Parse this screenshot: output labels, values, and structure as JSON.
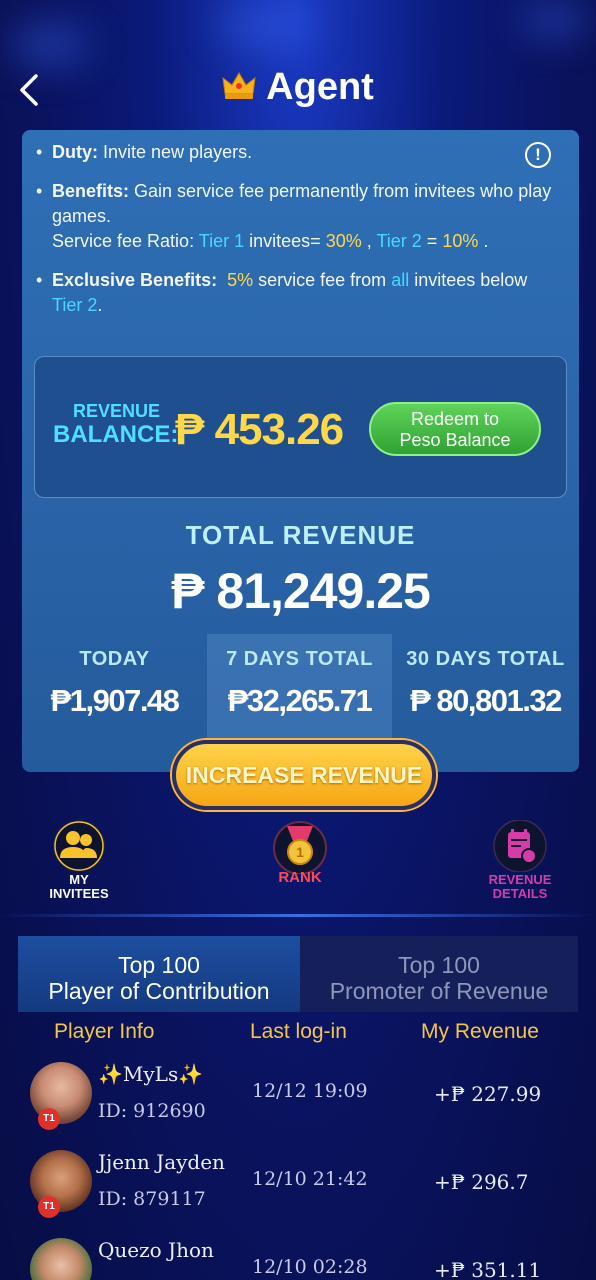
{
  "header": {
    "title": "Agent"
  },
  "info": {
    "duty_label": "Duty:",
    "duty_text": "Invite new players.",
    "benefits_label": "Benefits:",
    "benefits_text": "Gain service fee permanently from invitees who play games.",
    "ratio_prefix": "Service fee Ratio:",
    "tier1": "Tier 1",
    "invitees_eq": "invitees=",
    "tier1_pct": "30%",
    "comma": ",",
    "tier2": "Tier 2",
    "eq": "=",
    "tier2_pct": "10%",
    "period": ".",
    "excl_label": "Exclusive Benefits:",
    "excl_pct": "5%",
    "excl_mid": "service fee from",
    "all": "all",
    "excl_tail": "invitees below",
    "excl_tier": "Tier 2",
    "excl_end": "."
  },
  "balance": {
    "label_line1": "REVENUE",
    "label_line2": "BALANCE:",
    "value": "₱ 453.26",
    "redeem_line1": "Redeem to",
    "redeem_line2": "Peso Balance"
  },
  "total": {
    "label": "TOTAL  REVENUE",
    "value": "₱ 81,249.25"
  },
  "stats": [
    {
      "label": "TODAY",
      "value": "₱1,907.48"
    },
    {
      "label": "7 DAYS TOTAL",
      "value": "₱32,265.71"
    },
    {
      "label": "30 DAYS TOTAL",
      "value": "₱ 80,801.32"
    }
  ],
  "increase_button": "INCREASE REVENUE",
  "shortcuts": {
    "invitees_l1": "MY",
    "invitees_l2": "INVITEES",
    "rank": "RANK",
    "details_l1": "REVENUE",
    "details_l2": "DETAILS"
  },
  "tabs": {
    "active_l1": "Top 100",
    "active_l2": "Player of Contribution",
    "inactive_l1": "Top 100",
    "inactive_l2": "Promoter of Revenue"
  },
  "table": {
    "headers": [
      "Player Info",
      "Last log-in",
      "My Revenue"
    ],
    "rows": [
      {
        "name": "✨MyLs✨",
        "id": "ID: 912690",
        "login": "12/12 19:09",
        "revenue": "+₱ 227.99",
        "badge": "T1"
      },
      {
        "name": "Jjenn Jayden",
        "id": "ID: 879117",
        "login": "12/10 21:42",
        "revenue": "+₱ 296.7",
        "badge": "T1"
      },
      {
        "name": "Quezo Jhon",
        "id": "",
        "login": "12/10 02:28",
        "revenue": "+₱ 351.11",
        "badge": ""
      }
    ]
  },
  "colors": {
    "accent_cyan": "#48d8ff",
    "accent_yellow": "#ffd84a",
    "button_green": "#2fa233",
    "button_orange": "#f5a614"
  }
}
